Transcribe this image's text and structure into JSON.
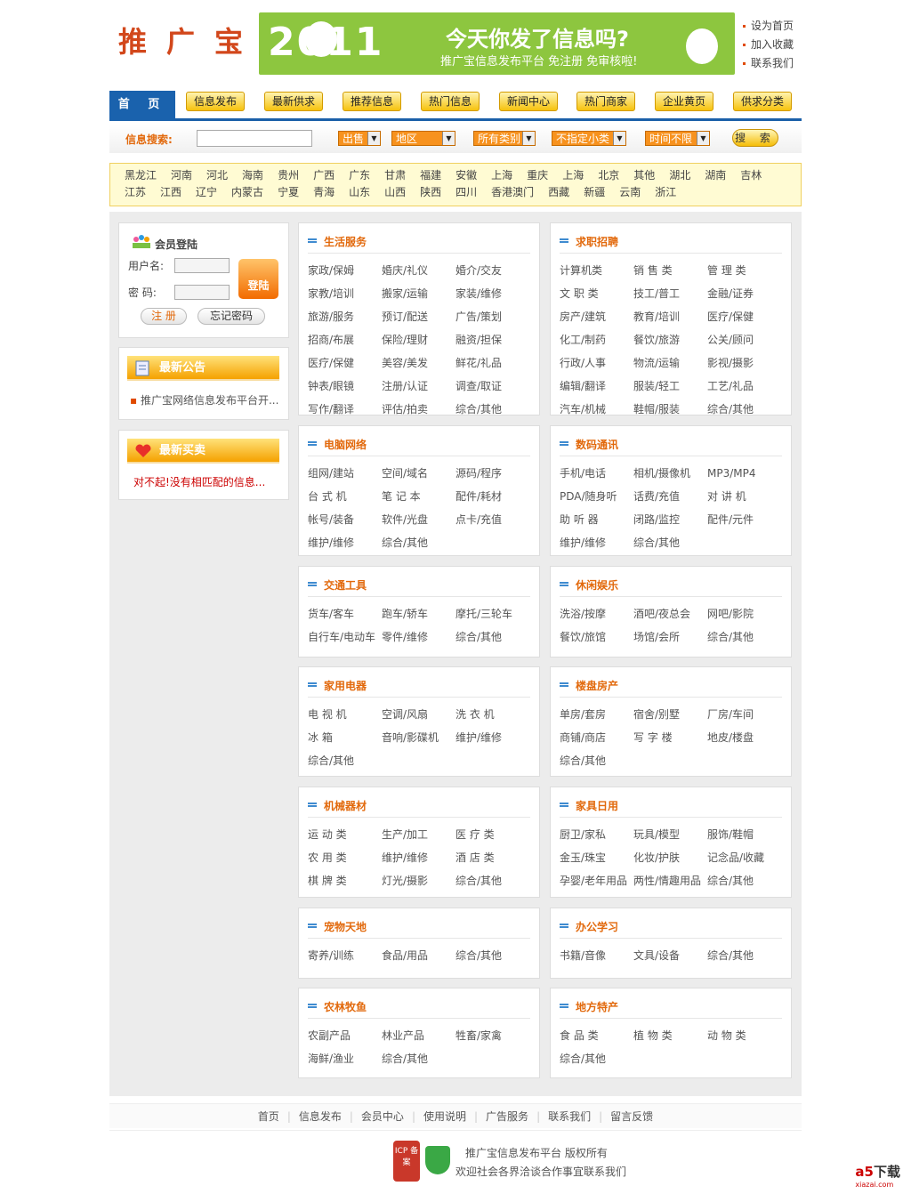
{
  "header": {
    "logo": "推广宝",
    "banner": {
      "year": "2011",
      "headline": "今天你发了信息吗?",
      "tagline": "推广宝信息发布平台 免注册 免审核啦!"
    },
    "toplinks": [
      "设为首页",
      "加入收藏",
      "联系我们"
    ]
  },
  "nav": {
    "home": "首 页",
    "items": [
      "信息发布",
      "最新供求",
      "推荐信息",
      "热门信息",
      "新闻中心",
      "热门商家",
      "企业黄页",
      "供求分类"
    ]
  },
  "search": {
    "label": "信息搜索:",
    "selects": [
      "出售",
      "地区",
      "所有类别",
      "不指定小类",
      "时间不限"
    ],
    "button": "搜 索"
  },
  "regions": [
    "黑龙江",
    "河南",
    "河北",
    "海南",
    "贵州",
    "广西",
    "广东",
    "甘肃",
    "福建",
    "安徽",
    "上海",
    "重庆",
    "上海",
    "北京",
    "其他",
    "湖北",
    "湖南",
    "吉林",
    "江苏",
    "江西",
    "辽宁",
    "内蒙古",
    "宁夏",
    "青海",
    "山东",
    "山西",
    "陕西",
    "四川",
    "香港澳门",
    "西藏",
    "新疆",
    "云南",
    "浙江"
  ],
  "login": {
    "title": "会员登陆",
    "username_label": "用户名:",
    "password_label": "密  码:",
    "login_button": "登陆",
    "register": "注 册",
    "forgot": "忘记密码"
  },
  "notice": {
    "title": "最新公告",
    "item": "推广宝网络信息发布平台开..."
  },
  "trade": {
    "title": "最新买卖",
    "message": "对不起!没有相匹配的信息..."
  },
  "categories": [
    {
      "title": "生活服务",
      "items": [
        "家政/保姆",
        "婚庆/礼仪",
        "婚介/交友",
        "家教/培训",
        "搬家/运输",
        "家装/维修",
        "旅游/服务",
        "预订/配送",
        "广告/策划",
        "招商/布展",
        "保险/理财",
        "融资/担保",
        "医疗/保健",
        "美容/美发",
        "鲜花/礼品",
        "钟表/眼镜",
        "注册/认证",
        "调查/取证",
        "写作/翻译",
        "评估/拍卖",
        "综合/其他"
      ]
    },
    {
      "title": "求职招聘",
      "items": [
        "计算机类",
        "销 售 类",
        "管 理 类",
        "文 职 类",
        "技工/普工",
        "金融/证券",
        "房产/建筑",
        "教育/培训",
        "医疗/保健",
        "化工/制药",
        "餐饮/旅游",
        "公关/顾问",
        "行政/人事",
        "物流/运输",
        "影视/摄影",
        "编辑/翻译",
        "服装/轻工",
        "工艺/礼品",
        "汽车/机械",
        "鞋帽/服装",
        "综合/其他"
      ]
    },
    {
      "title": "电脑网络",
      "items": [
        "组网/建站",
        "空间/域名",
        "源码/程序",
        "台 式 机",
        "笔 记 本",
        "配件/耗材",
        "帐号/装备",
        "软件/光盘",
        "点卡/充值",
        "维护/维修",
        "综合/其他"
      ]
    },
    {
      "title": "数码通讯",
      "items": [
        "手机/电话",
        "相机/摄像机",
        "MP3/MP4",
        "PDA/随身听",
        "话费/充值",
        "对 讲 机",
        "助 听 器",
        "闭路/监控",
        "配件/元件",
        "维护/维修",
        "综合/其他"
      ]
    },
    {
      "title": "交通工具",
      "items": [
        "货车/客车",
        "跑车/轿车",
        "摩托/三轮车",
        "自行车/电动车",
        "零件/维修",
        "综合/其他"
      ]
    },
    {
      "title": "休闲娱乐",
      "items": [
        "洗浴/按摩",
        "酒吧/夜总会",
        "网吧/影院",
        "餐饮/旅馆",
        "场馆/会所",
        "综合/其他"
      ]
    },
    {
      "title": "家用电器",
      "items": [
        "电 视 机",
        "空调/风扇",
        "洗 衣 机",
        "冰 箱",
        "音响/影碟机",
        "维护/维修",
        "综合/其他"
      ]
    },
    {
      "title": "楼盘房产",
      "items": [
        "单房/套房",
        "宿舍/别墅",
        "厂房/车间",
        "商铺/商店",
        "写 字 楼",
        "地皮/楼盘",
        "综合/其他"
      ]
    },
    {
      "title": "机械器材",
      "items": [
        "运 动 类",
        "生产/加工",
        "医 疗 类",
        "农 用 类",
        "维护/维修",
        "酒 店 类",
        "棋 牌 类",
        "灯光/摄影",
        "综合/其他"
      ]
    },
    {
      "title": "家具日用",
      "items": [
        "厨卫/家私",
        "玩具/模型",
        "服饰/鞋帽",
        "金玉/珠宝",
        "化妆/护肤",
        "记念品/收藏",
        "孕婴/老年用品",
        "两性/情趣用品",
        "综合/其他"
      ]
    },
    {
      "title": "宠物天地",
      "items": [
        "寄养/训练",
        "食品/用品",
        "综合/其他"
      ]
    },
    {
      "title": "办公学习",
      "items": [
        "书籍/音像",
        "文具/设备",
        "综合/其他"
      ]
    },
    {
      "title": "农林牧鱼",
      "items": [
        "农副产品",
        "林业产品",
        "牲畜/家禽",
        "海鲜/渔业",
        "综合/其他"
      ]
    },
    {
      "title": "地方特产",
      "items": [
        "食 品 类",
        "植 物 类",
        "动 物 类",
        "综合/其他"
      ]
    }
  ],
  "footer": {
    "links": [
      "首页",
      "信息发布",
      "会员中心",
      "使用说明",
      "广告服务",
      "联系我们",
      "留言反馈"
    ],
    "copyright": "推广宝信息发布平台 版权所有",
    "contact": "欢迎社会各界洽谈合作事宜联系我们",
    "icp": "ICP 备案"
  },
  "watermark": {
    "logo": "a5",
    "text": "下载",
    "domain": "xiazai.com"
  }
}
